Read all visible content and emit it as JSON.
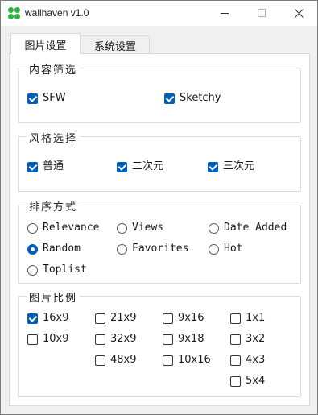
{
  "window": {
    "title": "wallhaven v1.0",
    "icon": "clover-icon",
    "controls": [
      "minimize",
      "maximize",
      "close"
    ]
  },
  "tabs": [
    {
      "label": "图片设置",
      "active": true
    },
    {
      "label": "系统设置",
      "active": false
    }
  ],
  "content_filter": {
    "title": "内容筛选",
    "options": [
      {
        "label": "SFW",
        "checked": true
      },
      {
        "label": "Sketchy",
        "checked": true
      }
    ]
  },
  "style_select": {
    "title": "风格选择",
    "options": [
      {
        "label": "普通",
        "checked": true
      },
      {
        "label": "二次元",
        "checked": true
      },
      {
        "label": "三次元",
        "checked": true
      }
    ]
  },
  "sort_method": {
    "title": "排序方式",
    "selected": "Random",
    "options": [
      {
        "label": "Relevance",
        "selected": false
      },
      {
        "label": "Views",
        "selected": false
      },
      {
        "label": "Date Added",
        "selected": false
      },
      {
        "label": "Random",
        "selected": true
      },
      {
        "label": "Favorites",
        "selected": false
      },
      {
        "label": "Hot",
        "selected": false
      },
      {
        "label": "Toplist",
        "selected": false
      }
    ]
  },
  "aspect_ratio": {
    "title": "图片比例",
    "options": [
      {
        "label": "16x9",
        "checked": true
      },
      {
        "label": "21x9",
        "checked": false
      },
      {
        "label": "9x16",
        "checked": false
      },
      {
        "label": "1x1",
        "checked": false
      },
      {
        "label": "10x9",
        "checked": false
      },
      {
        "label": "32x9",
        "checked": false
      },
      {
        "label": "9x18",
        "checked": false
      },
      {
        "label": "3x2",
        "checked": false
      },
      {
        "label": "48x9",
        "checked": false
      },
      {
        "label": "10x16",
        "checked": false
      },
      {
        "label": "4x3",
        "checked": false
      },
      {
        "label": "5x4",
        "checked": false
      }
    ]
  },
  "colors": {
    "accent": "#005fb8",
    "icon_green": "#2fb344"
  }
}
